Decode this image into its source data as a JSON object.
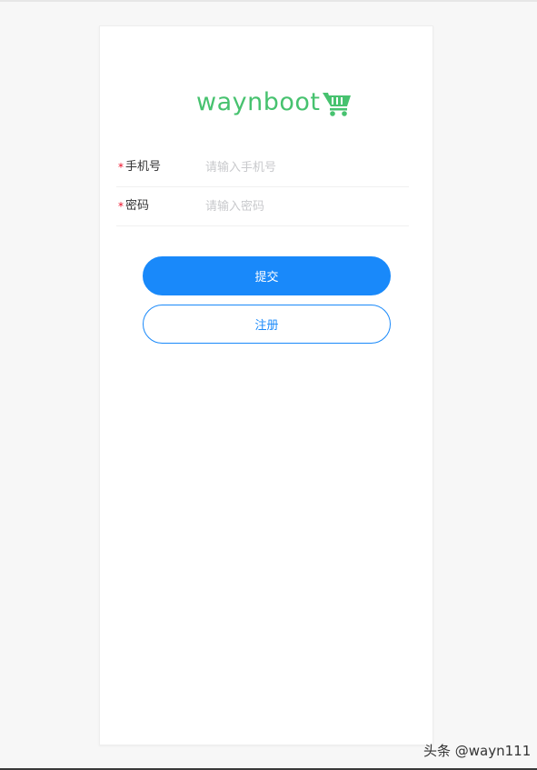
{
  "logo": {
    "text": "waynboot",
    "icon": "shopping-cart-icon",
    "color": "#47c26f"
  },
  "form": {
    "phone": {
      "required_mark": "*",
      "label": "手机号",
      "placeholder": "请输入手机号",
      "value": ""
    },
    "password": {
      "required_mark": "*",
      "label": "密码",
      "placeholder": "请输入密码",
      "value": ""
    }
  },
  "buttons": {
    "submit_label": "提交",
    "register_label": "注册"
  },
  "colors": {
    "primary": "#1989fa",
    "required": "#ee0a24",
    "placeholder": "#c8c9cc"
  },
  "watermark": {
    "text": "头条 @wayn111"
  }
}
